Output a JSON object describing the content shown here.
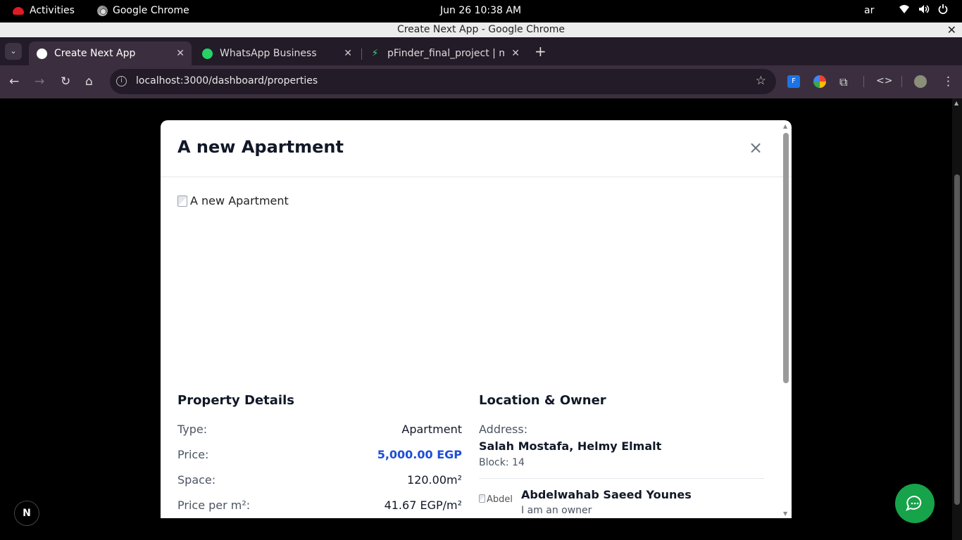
{
  "os": {
    "activities": "Activities",
    "app_name": "Google Chrome",
    "clock": "Jun 26  10:38 AM",
    "lang": "ar"
  },
  "window": {
    "title": "Create Next App - Google Chrome"
  },
  "tabs": [
    {
      "label": "Create Next App",
      "active": true
    },
    {
      "label": "WhatsApp Business",
      "active": false
    },
    {
      "label": "pFinder_final_project | m",
      "active": false
    }
  ],
  "toolbar": {
    "url": "localhost:3000/dashboard/properties"
  },
  "modal": {
    "title": "A new Apartment",
    "image_alt": "A new Apartment",
    "details": {
      "heading": "Property Details",
      "rows": [
        {
          "key": "Type:",
          "value": "Apartment"
        },
        {
          "key": "Price:",
          "value": "5,000.00 EGP"
        },
        {
          "key": "Space:",
          "value": "120.00m²"
        },
        {
          "key": "Price per m²:",
          "value": "41.67 EGP/m²"
        }
      ]
    },
    "location": {
      "heading": "Location & Owner",
      "address_label": "Address:",
      "address": "Salah Mostafa, Helmy Elmalt",
      "block": "Block: 14",
      "owner_img_alt": "Abdel",
      "owner_name": "Abdelwahab Saeed Younes",
      "owner_role": "I am an owner"
    }
  },
  "badge": {
    "label": "N"
  },
  "colors": {
    "price": "#1d4ed8",
    "fab": "#16a34a",
    "tab_bg": "#3b2f3f"
  }
}
